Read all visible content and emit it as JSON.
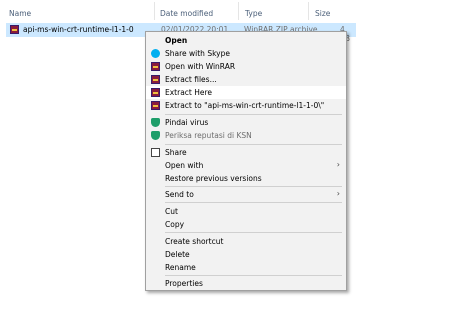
{
  "columns": {
    "name": "Name",
    "date": "Date modified",
    "type": "Type",
    "size": "Size"
  },
  "file": {
    "icon": "winrar-icon",
    "name": "api-ms-win-crt-runtime-l1-1-0",
    "date": "02/01/2022 20:01",
    "type": "WinRAR ZIP archive",
    "size": "4 KB"
  },
  "menu": {
    "open": "Open",
    "share_skype": "Share with Skype",
    "open_winrar": "Open with WinRAR",
    "extract_files": "Extract files...",
    "extract_here": "Extract Here",
    "extract_to": "Extract to \"api-ms-win-crt-runtime-l1-1-0\\\"",
    "pindai_virus": "Pindai virus",
    "periksa_reputasi": "Periksa reputasi di KSN",
    "share": "Share",
    "open_with": "Open with",
    "restore_versions": "Restore previous versions",
    "send_to": "Send to",
    "cut": "Cut",
    "copy": "Copy",
    "create_shortcut": "Create shortcut",
    "delete": "Delete",
    "rename": "Rename",
    "properties": "Properties"
  },
  "colors": {
    "selection": "#cce8ff",
    "menu_bg": "#f2f2f2",
    "highlight": "#ffffff"
  }
}
